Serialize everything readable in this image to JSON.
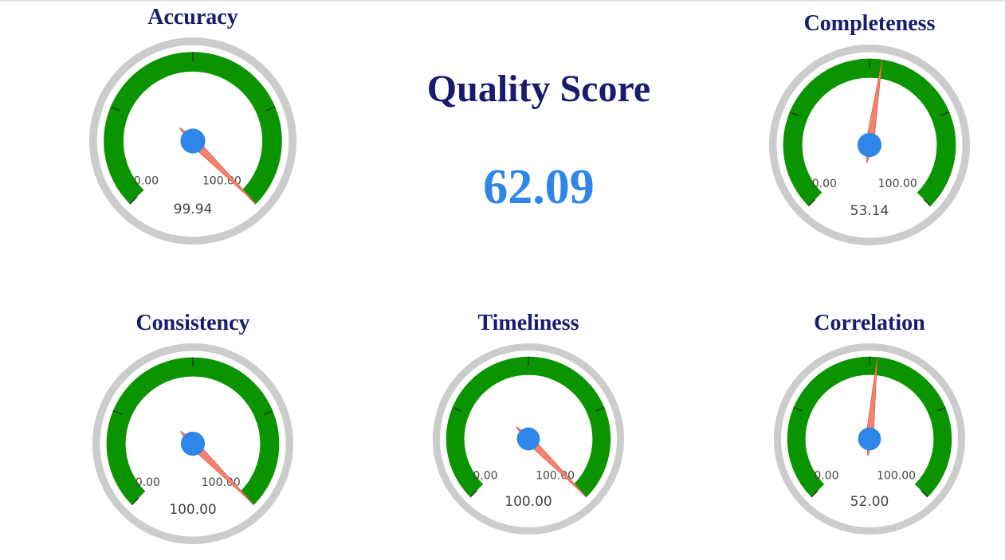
{
  "quality_score": {
    "title": "Quality Score",
    "value": "62.09"
  },
  "gauges": [
    {
      "id": "accuracy",
      "title": "Accuracy",
      "min_label": "0.00",
      "max_label": "100.00",
      "value_label": "99.94",
      "value": 99.94
    },
    {
      "id": "completeness",
      "title": "Completeness",
      "min_label": "0.00",
      "max_label": "100.00",
      "value_label": "53.14",
      "value": 53.14
    },
    {
      "id": "consistency",
      "title": "Consistency",
      "min_label": "0.00",
      "max_label": "100.00",
      "value_label": "100.00",
      "value": 100.0
    },
    {
      "id": "timeliness",
      "title": "Timeliness",
      "min_label": "0.00",
      "max_label": "100.00",
      "value_label": "100.00",
      "value": 100.0
    },
    {
      "id": "correlation",
      "title": "Correlation",
      "min_label": "0.00",
      "max_label": "100.00",
      "value_label": "52.00",
      "value": 52.0
    }
  ],
  "colors": {
    "band": "#0a9400",
    "bezel": "#cccccc",
    "needle": "#f4826d",
    "hub": "#2e86e8",
    "title": "#1a1a6e",
    "score": "#2e86e8"
  }
}
